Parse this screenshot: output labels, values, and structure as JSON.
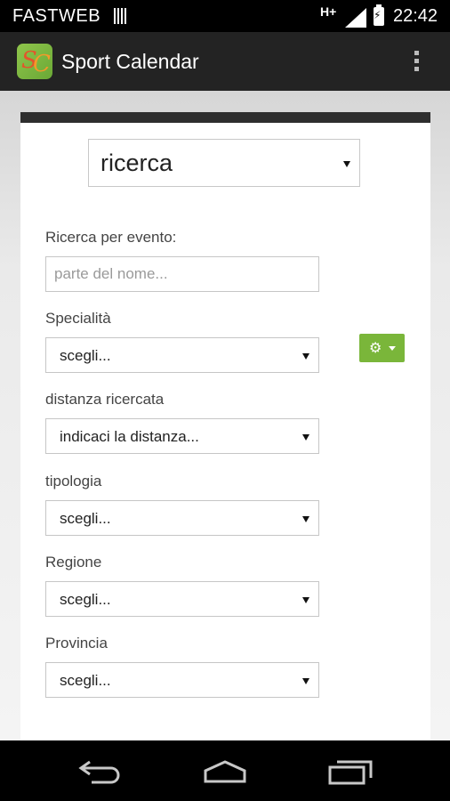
{
  "status_bar": {
    "carrier": "FASTWEB",
    "network": "H+",
    "time": "22:42",
    "icons": [
      "sim-icon",
      "signal-icon",
      "battery-charging-icon"
    ]
  },
  "action_bar": {
    "app_title": "Sport Calendar",
    "icons": [
      "app-logo",
      "overflow-menu-icon"
    ]
  },
  "form": {
    "mode_select": {
      "value": "ricerca"
    },
    "event_search": {
      "label": "Ricerca per evento:",
      "placeholder": "parte del nome..."
    },
    "specialita": {
      "label": "Specialità",
      "value": "scegli..."
    },
    "distanza": {
      "label": "distanza ricercata",
      "value": "indicaci la distanza..."
    },
    "tipologia": {
      "label": "tipologia",
      "value": "scegli..."
    },
    "regione": {
      "label": "Regione",
      "value": "scegli..."
    },
    "provincia": {
      "label": "Provincia",
      "value": "scegli..."
    },
    "settings_button": {
      "icon": "gear-icon"
    },
    "colors": {
      "accent_green": "#7ab63a",
      "action_bar": "#232323"
    }
  },
  "nav_bar": {
    "icons": [
      "back-icon",
      "home-icon",
      "recent-apps-icon"
    ]
  }
}
